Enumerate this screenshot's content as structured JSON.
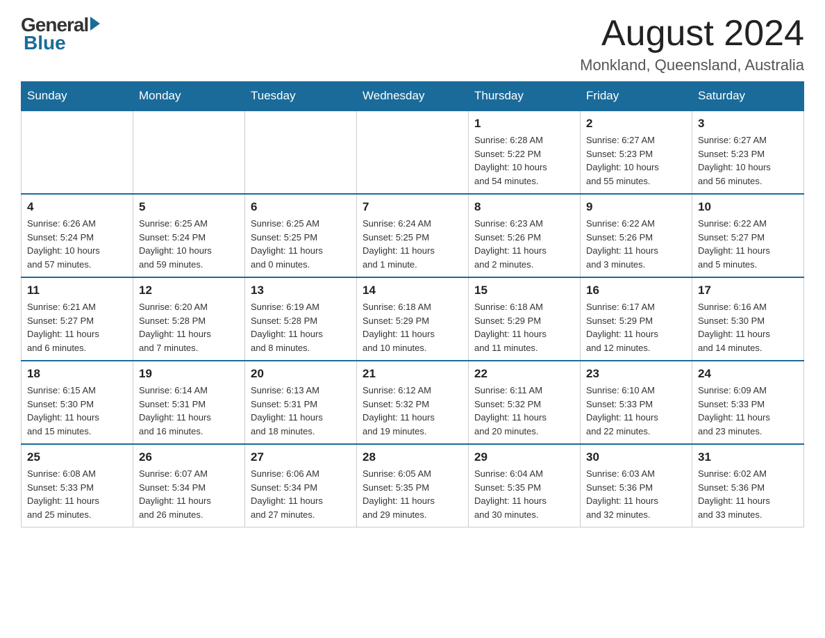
{
  "header": {
    "logo_general": "General",
    "logo_blue": "Blue",
    "month_title": "August 2024",
    "location": "Monkland, Queensland, Australia"
  },
  "days_of_week": [
    "Sunday",
    "Monday",
    "Tuesday",
    "Wednesday",
    "Thursday",
    "Friday",
    "Saturday"
  ],
  "weeks": [
    {
      "days": [
        {
          "date": "",
          "info": ""
        },
        {
          "date": "",
          "info": ""
        },
        {
          "date": "",
          "info": ""
        },
        {
          "date": "",
          "info": ""
        },
        {
          "date": "1",
          "info": "Sunrise: 6:28 AM\nSunset: 5:22 PM\nDaylight: 10 hours\nand 54 minutes."
        },
        {
          "date": "2",
          "info": "Sunrise: 6:27 AM\nSunset: 5:23 PM\nDaylight: 10 hours\nand 55 minutes."
        },
        {
          "date": "3",
          "info": "Sunrise: 6:27 AM\nSunset: 5:23 PM\nDaylight: 10 hours\nand 56 minutes."
        }
      ]
    },
    {
      "days": [
        {
          "date": "4",
          "info": "Sunrise: 6:26 AM\nSunset: 5:24 PM\nDaylight: 10 hours\nand 57 minutes."
        },
        {
          "date": "5",
          "info": "Sunrise: 6:25 AM\nSunset: 5:24 PM\nDaylight: 10 hours\nand 59 minutes."
        },
        {
          "date": "6",
          "info": "Sunrise: 6:25 AM\nSunset: 5:25 PM\nDaylight: 11 hours\nand 0 minutes."
        },
        {
          "date": "7",
          "info": "Sunrise: 6:24 AM\nSunset: 5:25 PM\nDaylight: 11 hours\nand 1 minute."
        },
        {
          "date": "8",
          "info": "Sunrise: 6:23 AM\nSunset: 5:26 PM\nDaylight: 11 hours\nand 2 minutes."
        },
        {
          "date": "9",
          "info": "Sunrise: 6:22 AM\nSunset: 5:26 PM\nDaylight: 11 hours\nand 3 minutes."
        },
        {
          "date": "10",
          "info": "Sunrise: 6:22 AM\nSunset: 5:27 PM\nDaylight: 11 hours\nand 5 minutes."
        }
      ]
    },
    {
      "days": [
        {
          "date": "11",
          "info": "Sunrise: 6:21 AM\nSunset: 5:27 PM\nDaylight: 11 hours\nand 6 minutes."
        },
        {
          "date": "12",
          "info": "Sunrise: 6:20 AM\nSunset: 5:28 PM\nDaylight: 11 hours\nand 7 minutes."
        },
        {
          "date": "13",
          "info": "Sunrise: 6:19 AM\nSunset: 5:28 PM\nDaylight: 11 hours\nand 8 minutes."
        },
        {
          "date": "14",
          "info": "Sunrise: 6:18 AM\nSunset: 5:29 PM\nDaylight: 11 hours\nand 10 minutes."
        },
        {
          "date": "15",
          "info": "Sunrise: 6:18 AM\nSunset: 5:29 PM\nDaylight: 11 hours\nand 11 minutes."
        },
        {
          "date": "16",
          "info": "Sunrise: 6:17 AM\nSunset: 5:29 PM\nDaylight: 11 hours\nand 12 minutes."
        },
        {
          "date": "17",
          "info": "Sunrise: 6:16 AM\nSunset: 5:30 PM\nDaylight: 11 hours\nand 14 minutes."
        }
      ]
    },
    {
      "days": [
        {
          "date": "18",
          "info": "Sunrise: 6:15 AM\nSunset: 5:30 PM\nDaylight: 11 hours\nand 15 minutes."
        },
        {
          "date": "19",
          "info": "Sunrise: 6:14 AM\nSunset: 5:31 PM\nDaylight: 11 hours\nand 16 minutes."
        },
        {
          "date": "20",
          "info": "Sunrise: 6:13 AM\nSunset: 5:31 PM\nDaylight: 11 hours\nand 18 minutes."
        },
        {
          "date": "21",
          "info": "Sunrise: 6:12 AM\nSunset: 5:32 PM\nDaylight: 11 hours\nand 19 minutes."
        },
        {
          "date": "22",
          "info": "Sunrise: 6:11 AM\nSunset: 5:32 PM\nDaylight: 11 hours\nand 20 minutes."
        },
        {
          "date": "23",
          "info": "Sunrise: 6:10 AM\nSunset: 5:33 PM\nDaylight: 11 hours\nand 22 minutes."
        },
        {
          "date": "24",
          "info": "Sunrise: 6:09 AM\nSunset: 5:33 PM\nDaylight: 11 hours\nand 23 minutes."
        }
      ]
    },
    {
      "days": [
        {
          "date": "25",
          "info": "Sunrise: 6:08 AM\nSunset: 5:33 PM\nDaylight: 11 hours\nand 25 minutes."
        },
        {
          "date": "26",
          "info": "Sunrise: 6:07 AM\nSunset: 5:34 PM\nDaylight: 11 hours\nand 26 minutes."
        },
        {
          "date": "27",
          "info": "Sunrise: 6:06 AM\nSunset: 5:34 PM\nDaylight: 11 hours\nand 27 minutes."
        },
        {
          "date": "28",
          "info": "Sunrise: 6:05 AM\nSunset: 5:35 PM\nDaylight: 11 hours\nand 29 minutes."
        },
        {
          "date": "29",
          "info": "Sunrise: 6:04 AM\nSunset: 5:35 PM\nDaylight: 11 hours\nand 30 minutes."
        },
        {
          "date": "30",
          "info": "Sunrise: 6:03 AM\nSunset: 5:36 PM\nDaylight: 11 hours\nand 32 minutes."
        },
        {
          "date": "31",
          "info": "Sunrise: 6:02 AM\nSunset: 5:36 PM\nDaylight: 11 hours\nand 33 minutes."
        }
      ]
    }
  ]
}
